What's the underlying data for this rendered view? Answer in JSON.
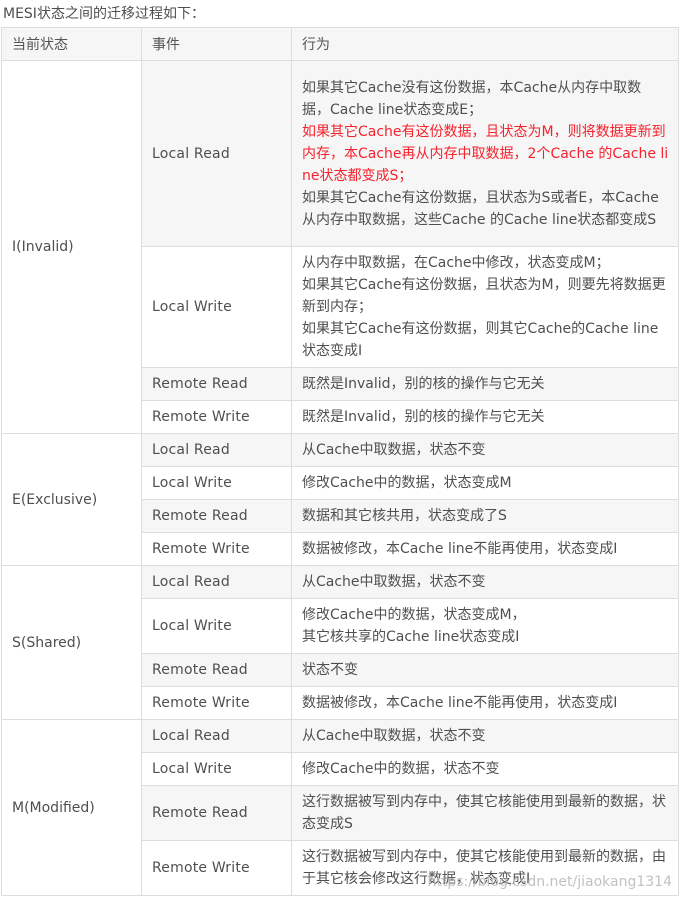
{
  "caption": "MESI状态之间的迁移过程如下：",
  "headers": {
    "state": "当前状态",
    "event": "事件",
    "action": "行为"
  },
  "groups": [
    {
      "state": "I(Invalid)",
      "rows": [
        {
          "event": "Local Read",
          "lines": [
            {
              "text": "如果其它Cache没有这份数据，本Cache从内存中取数据，Cache line状态变成E；",
              "color": "#4f4f4f"
            },
            {
              "text": "如果其它Cache有这份数据，且状态为M，则将数据更新到内存，本Cache再从内存中取数据，2个Cache 的Cache line状态都变成S；",
              "color": "#f5222d"
            },
            {
              "text": "如果其它Cache有这份数据，且状态为S或者E，本Cache从内存中取数据，这些Cache 的Cache line状态都变成S",
              "color": "#4f4f4f"
            }
          ]
        },
        {
          "event": "Local Write",
          "lines": [
            {
              "text": "从内存中取数据，在Cache中修改，状态变成M；",
              "color": "#4f4f4f"
            },
            {
              "text": "如果其它Cache有这份数据，且状态为M，则要先将数据更新到内存；",
              "color": "#4f4f4f"
            },
            {
              "text": "如果其它Cache有这份数据，则其它Cache的Cache line状态变成I",
              "color": "#4f4f4f"
            }
          ]
        },
        {
          "event": "Remote Read",
          "lines": [
            {
              "text": "既然是Invalid，别的核的操作与它无关",
              "color": "#4f4f4f"
            }
          ]
        },
        {
          "event": "Remote Write",
          "lines": [
            {
              "text": "既然是Invalid，别的核的操作与它无关",
              "color": "#4f4f4f"
            }
          ]
        }
      ]
    },
    {
      "state": "E(Exclusive)",
      "rows": [
        {
          "event": "Local Read",
          "lines": [
            {
              "text": "从Cache中取数据，状态不变",
              "color": "#4f4f4f"
            }
          ]
        },
        {
          "event": "Local Write",
          "lines": [
            {
              "text": "修改Cache中的数据，状态变成M",
              "color": "#4f4f4f"
            }
          ]
        },
        {
          "event": "Remote Read",
          "lines": [
            {
              "text": "数据和其它核共用，状态变成了S",
              "color": "#4f4f4f"
            }
          ]
        },
        {
          "event": "Remote Write",
          "lines": [
            {
              "text": "数据被修改，本Cache line不能再使用，状态变成I",
              "color": "#4f4f4f"
            }
          ]
        }
      ]
    },
    {
      "state": "S(Shared)",
      "rows": [
        {
          "event": "Local Read",
          "lines": [
            {
              "text": "从Cache中取数据，状态不变",
              "color": "#4f4f4f"
            }
          ]
        },
        {
          "event": "Local Write",
          "lines": [
            {
              "text": "修改Cache中的数据，状态变成M，",
              "color": "#4f4f4f"
            },
            {
              "text": "其它核共享的Cache line状态变成I",
              "color": "#4f4f4f"
            }
          ]
        },
        {
          "event": "Remote Read",
          "lines": [
            {
              "text": "状态不变",
              "color": "#4f4f4f"
            }
          ]
        },
        {
          "event": "Remote Write",
          "lines": [
            {
              "text": "数据被修改，本Cache line不能再使用，状态变成I",
              "color": "#4f4f4f"
            }
          ]
        }
      ]
    },
    {
      "state": "M(Modified)",
      "rows": [
        {
          "event": "Local Read",
          "lines": [
            {
              "text": "从Cache中取数据，状态不变",
              "color": "#4f4f4f"
            }
          ]
        },
        {
          "event": "Local Write",
          "lines": [
            {
              "text": "修改Cache中的数据，状态不变",
              "color": "#4f4f4f"
            }
          ]
        },
        {
          "event": "Remote Read",
          "lines": [
            {
              "text": "这行数据被写到内存中，使其它核能使用到最新的数据，状态变成S",
              "color": "#4f4f4f"
            }
          ]
        },
        {
          "event": "Remote Write",
          "lines": [
            {
              "text": "这行数据被写到内存中，使其它核能使用到最新的数据，由于其它核会修改这行数据，状态变成I",
              "color": "#4f4f4f"
            }
          ]
        }
      ]
    }
  ],
  "watermark": "https://blog.csdn.net/jiaokang1314"
}
